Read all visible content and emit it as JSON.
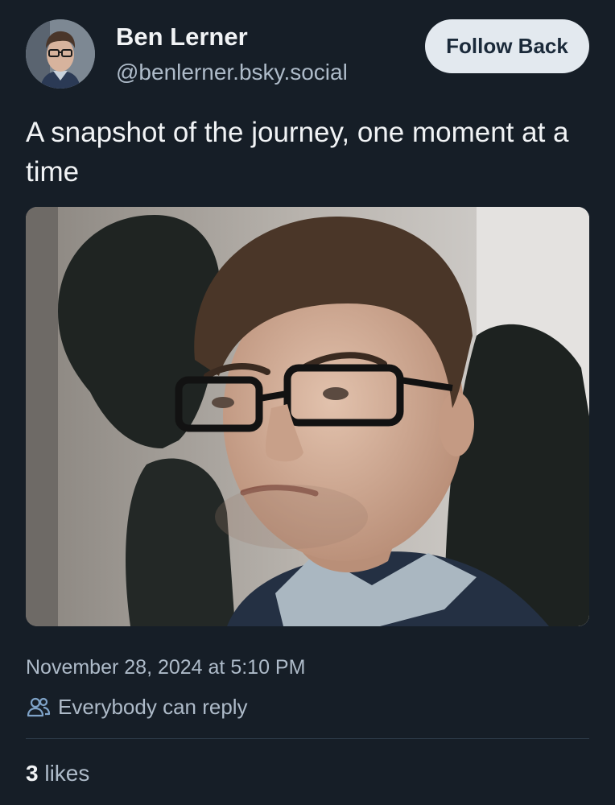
{
  "author": {
    "name": "Ben Lerner",
    "handle": "@benlerner.bsky.social",
    "avatar_icon": "profile-photo"
  },
  "follow_button": {
    "label": "Follow Back"
  },
  "post": {
    "text": "A snapshot of the journey, one moment at a time",
    "image_icon": "portrait-photo",
    "timestamp": "November 28, 2024 at 5:10 PM",
    "reply_setting": {
      "icon": "people-icon",
      "label": "Everybody can reply"
    },
    "likes": {
      "count": "3",
      "label": "likes"
    }
  },
  "colors": {
    "background": "#161e27",
    "primary_text": "#f1f3f5",
    "secondary_text": "#aebbc9",
    "button_bg": "#e3e9ef",
    "button_text": "#1b2a3a",
    "divider": "#2d3a48"
  }
}
